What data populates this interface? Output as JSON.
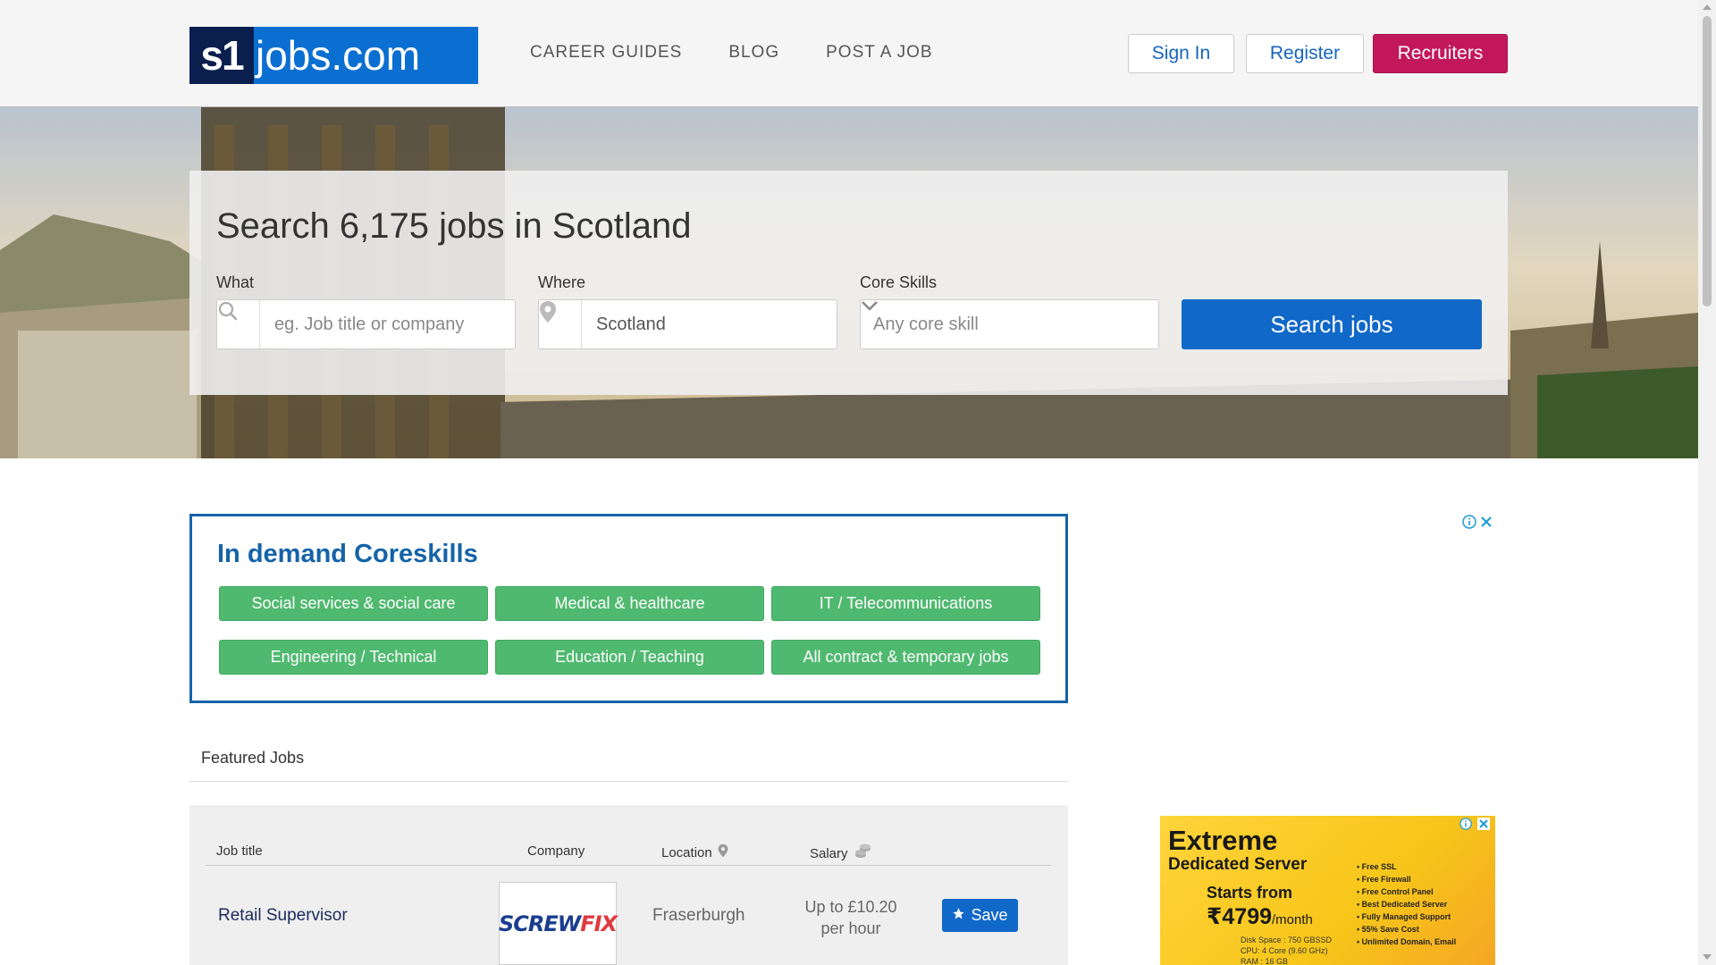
{
  "header": {
    "logo_s1": "s1",
    "logo_rest": "jobs.com",
    "nav": [
      "CAREER GUIDES",
      "BLOG",
      "POST A JOB"
    ],
    "sign_in": "Sign In",
    "register": "Register",
    "recruiters": "Recruiters"
  },
  "search": {
    "title": "Search 6,175 jobs in Scotland",
    "what_label": "What",
    "what_placeholder": "eg. Job title or company",
    "where_label": "Where",
    "where_value": "Scotland",
    "core_label": "Core Skills",
    "core_value": "Any core skill",
    "button": "Search jobs"
  },
  "coreskills": {
    "heading": "In demand Coreskills",
    "items": [
      "Social services & social care",
      "Medical & healthcare",
      "IT / Telecommunications",
      "Engineering / Technical",
      "Education / Teaching",
      "All contract & temporary jobs"
    ]
  },
  "featured": {
    "label": "Featured Jobs",
    "headers": {
      "job_title": "Job title",
      "company": "Company",
      "location": "Location",
      "salary": "Salary"
    },
    "rows": [
      {
        "title": "Retail Supervisor",
        "company_logo_a": "SCREW",
        "company_logo_b": "FIX",
        "location": "Fraserburgh",
        "salary_line1": "Up to £10.20",
        "salary_line2": "per hour",
        "save": "Save"
      }
    ]
  },
  "ad": {
    "title": "Extreme",
    "subtitle": "Dedicated Server",
    "starts": "Starts from",
    "price": "₹4799",
    "per": "/month",
    "specs": [
      "Disk Space : 750 GBSSD",
      "CPU: 4 Core (9.60 GHz)",
      "RAM : 16 GB"
    ],
    "features": [
      "Free SSL",
      "Free Firewall",
      "Free Control Panel",
      "Best Dedicated Server",
      "Fully Managed Support",
      "55% Save Cost",
      "Unlimited Domain, Email"
    ]
  },
  "colors": {
    "brand_blue": "#1068c8",
    "recruiters": "#c2185b",
    "chip_green": "#4fb96f",
    "coreskills_border": "#1563a8"
  },
  "icons": [
    "search-icon",
    "map-pin-icon",
    "chevron-down-icon",
    "star-icon",
    "coins-icon",
    "ad-info-icon",
    "ad-close-icon"
  ]
}
